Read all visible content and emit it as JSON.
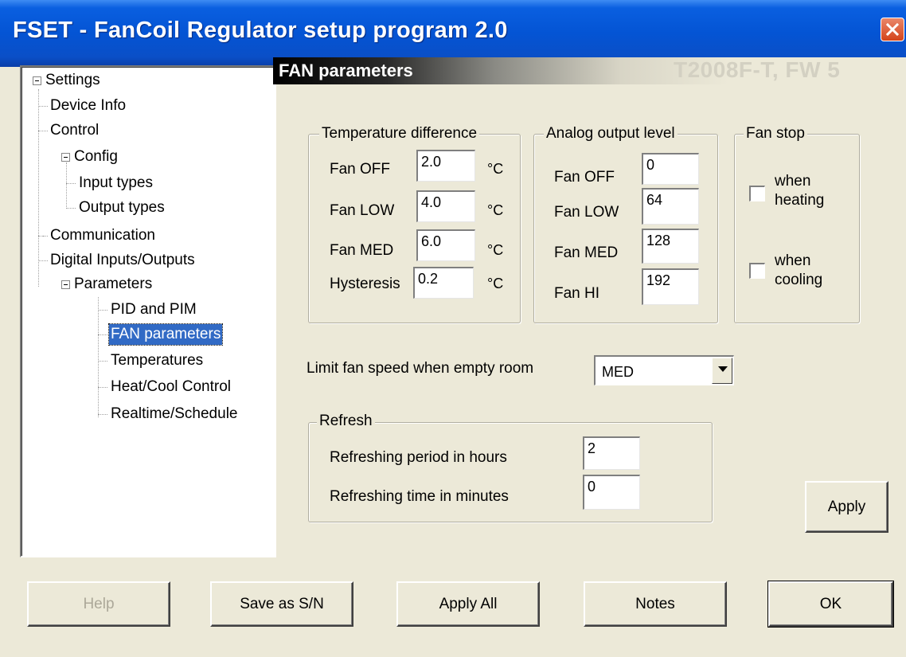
{
  "window": {
    "title": "FSET - FanCoil Regulator setup program 2.0"
  },
  "header": {
    "title": "FAN parameters",
    "model": "T2008F-T, FW 5"
  },
  "tree": {
    "settings": "Settings",
    "device_info": "Device Info",
    "control": "Control",
    "config": "Config",
    "input_types": "Input types",
    "output_types": "Output types",
    "communication": "Communication",
    "digital_io": "Digital Inputs/Outputs",
    "parameters": "Parameters",
    "pid_pim": "PID and PIM",
    "fan_parameters": "FAN parameters",
    "temperatures": "Temperatures",
    "heat_cool": "Heat/Cool Control",
    "realtime": "Realtime/Schedule"
  },
  "temp_diff": {
    "legend": "Temperature difference",
    "rows": [
      {
        "label": "Fan OFF",
        "value": "2.0",
        "unit": "°C"
      },
      {
        "label": "Fan LOW",
        "value": "4.0",
        "unit": "°C"
      },
      {
        "label": "Fan MED",
        "value": "6.0",
        "unit": "°C"
      },
      {
        "label": "Hysteresis",
        "value": "0.2",
        "unit": "°C"
      }
    ]
  },
  "analog": {
    "legend": "Analog output level",
    "rows": [
      {
        "label": "Fan OFF",
        "value": "0"
      },
      {
        "label": "Fan LOW",
        "value": "64"
      },
      {
        "label": "Fan MED",
        "value": "128"
      },
      {
        "label": "Fan HI",
        "value": "192"
      }
    ]
  },
  "fan_stop": {
    "legend": "Fan stop",
    "heating": {
      "line1": "when",
      "line2": "heating",
      "checked": false
    },
    "cooling": {
      "line1": "when",
      "line2": "cooling",
      "checked": false
    }
  },
  "limit": {
    "label": "Limit fan speed when empty room",
    "value": "MED"
  },
  "refresh": {
    "legend": "Refresh",
    "period_label": "Refreshing period in hours",
    "period_value": "2",
    "time_label": "Refreshing time in minutes",
    "time_value": "0"
  },
  "buttons": {
    "apply": "Apply",
    "help": "Help",
    "save_sn": "Save as S/N",
    "apply_all": "Apply All",
    "notes": "Notes",
    "ok": "OK"
  }
}
